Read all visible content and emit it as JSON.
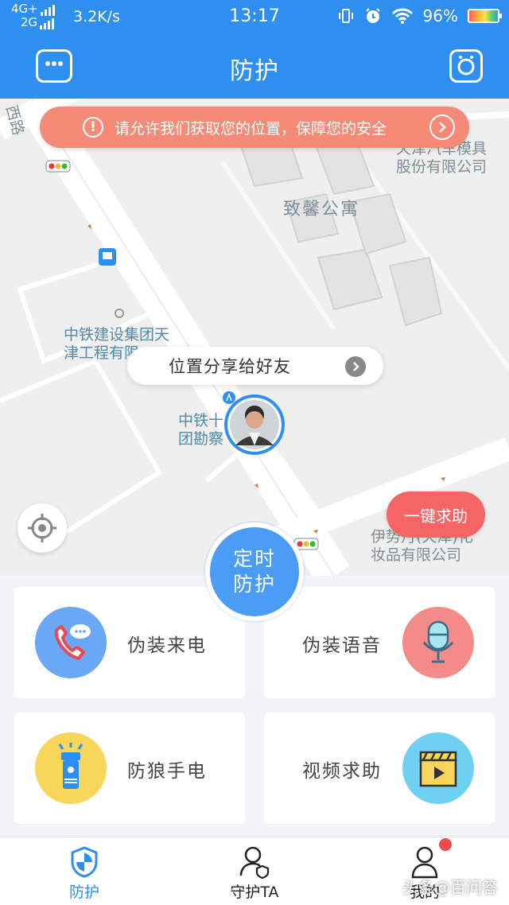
{
  "status_bar": {
    "net_top": "4G+",
    "net_bottom": "2G",
    "speed": "3.2K/s",
    "time": "13:17",
    "battery": "96%"
  },
  "header": {
    "title": "防护",
    "left_icon": "chat-bubble-icon",
    "right_icon": "robot-face-icon"
  },
  "map": {
    "permission_banner": "请允许我们获取您的位置，保障您的安全",
    "share_button": "位置分享给好友",
    "sos_button": "一键求助",
    "labels": {
      "road_west": "西路",
      "company1_line1": "天津汽车模具",
      "company1_line2": "股份有限公司",
      "apartment": "致馨公寓",
      "company2_line1": "中铁建设集团天",
      "company2_line2": "津工程有限",
      "company3_line1": "中铁十",
      "company3_line2": "团勘察",
      "company4_line1": "伊势丹(天津)化",
      "company4_line2": "妆品有限公司"
    }
  },
  "timer_button": {
    "line1": "定时",
    "line2": "防护"
  },
  "features": [
    {
      "label": "伪装来电",
      "icon": "phone-call-icon",
      "color": "#6aa7f5"
    },
    {
      "label": "伪装语音",
      "icon": "microphone-icon",
      "color": "#f48b8b"
    },
    {
      "label": "防狼手电",
      "icon": "flashlight-icon",
      "color": "#f7d65a"
    },
    {
      "label": "视频求助",
      "icon": "video-clapper-icon",
      "color": "#6fd0f2"
    }
  ],
  "tabs": [
    {
      "label": "防护",
      "icon": "shield-icon",
      "active": true
    },
    {
      "label": "守护TA",
      "icon": "guardian-person-icon",
      "active": false
    },
    {
      "label": "我的",
      "icon": "person-icon",
      "active": false
    }
  ],
  "watermark": "头条@百问答",
  "colors": {
    "primary": "#2f8ff0",
    "banner": "#f58a76",
    "sos": "#f66565"
  }
}
